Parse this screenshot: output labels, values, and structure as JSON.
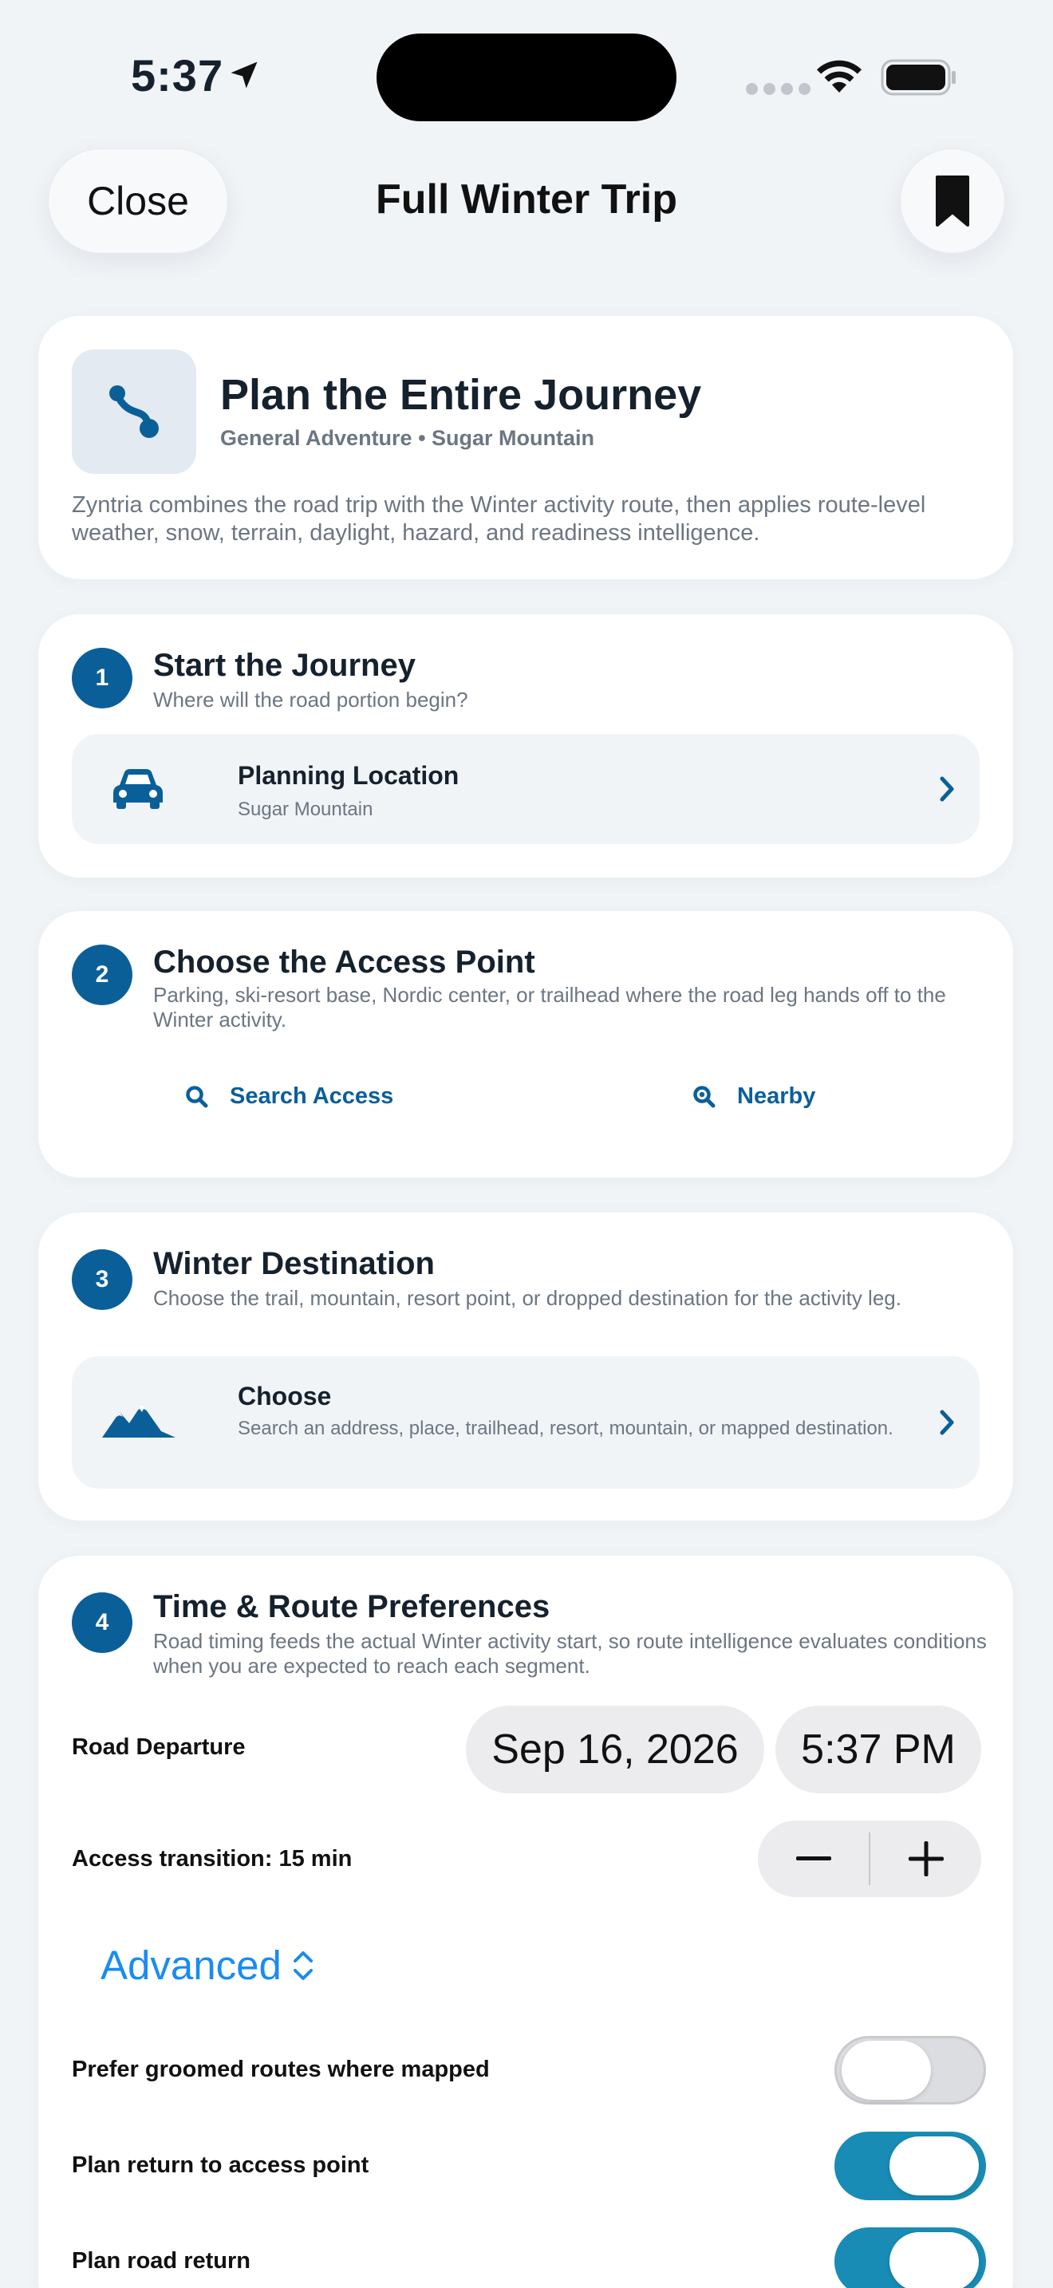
{
  "status": {
    "time": "5:37"
  },
  "nav": {
    "close_label": "Close",
    "title": "Full Winter Trip"
  },
  "hero": {
    "title": "Plan the Entire Journey",
    "subtitle": "General Adventure • Sugar Mountain",
    "description": "Zyntria combines the road trip with the Winter activity route, then applies route-level weather, snow, terrain, daylight, hazard, and readiness intelligence."
  },
  "steps": [
    {
      "number": "1",
      "title": "Start the Journey",
      "subtitle": "Where will the road portion begin?",
      "row": {
        "title": "Planning Location",
        "subtitle": "Sugar Mountain",
        "icon": "car-icon"
      }
    },
    {
      "number": "2",
      "title": "Choose the Access Point",
      "subtitle": "Parking, ski-resort base, Nordic center, or trailhead where the road leg hands off to the Winter activity.",
      "search_label": "Search Access",
      "nearby_label": "Nearby"
    },
    {
      "number": "3",
      "title": "Winter Destination",
      "subtitle": "Choose the trail, mountain, resort point, or dropped destination for the activity leg.",
      "row": {
        "title": "Choose",
        "subtitle": "Search an address, place, trailhead, resort, mountain, or mapped destination.",
        "icon": "mountains-icon"
      }
    },
    {
      "number": "4",
      "title": "Time & Route Preferences",
      "subtitle": "Road timing feeds the actual Winter activity start, so route intelligence evaluates conditions when you are expected to reach each segment."
    }
  ],
  "preferences": {
    "departure_label": "Road Departure",
    "departure_date": "Sep 16, 2026",
    "departure_time": "5:37 PM",
    "transition_label": "Access transition: 15 min",
    "advanced_label": "Advanced",
    "toggles": [
      {
        "label": "Prefer groomed routes where mapped",
        "on": false
      },
      {
        "label": "Plan return to access point",
        "on": true
      },
      {
        "label": "Plan road return",
        "on": true
      }
    ]
  },
  "colors": {
    "accent": "#0b5f99",
    "toggle_on": "#188cb5",
    "link": "#1a8cf0",
    "background": "#f1f4f7"
  }
}
